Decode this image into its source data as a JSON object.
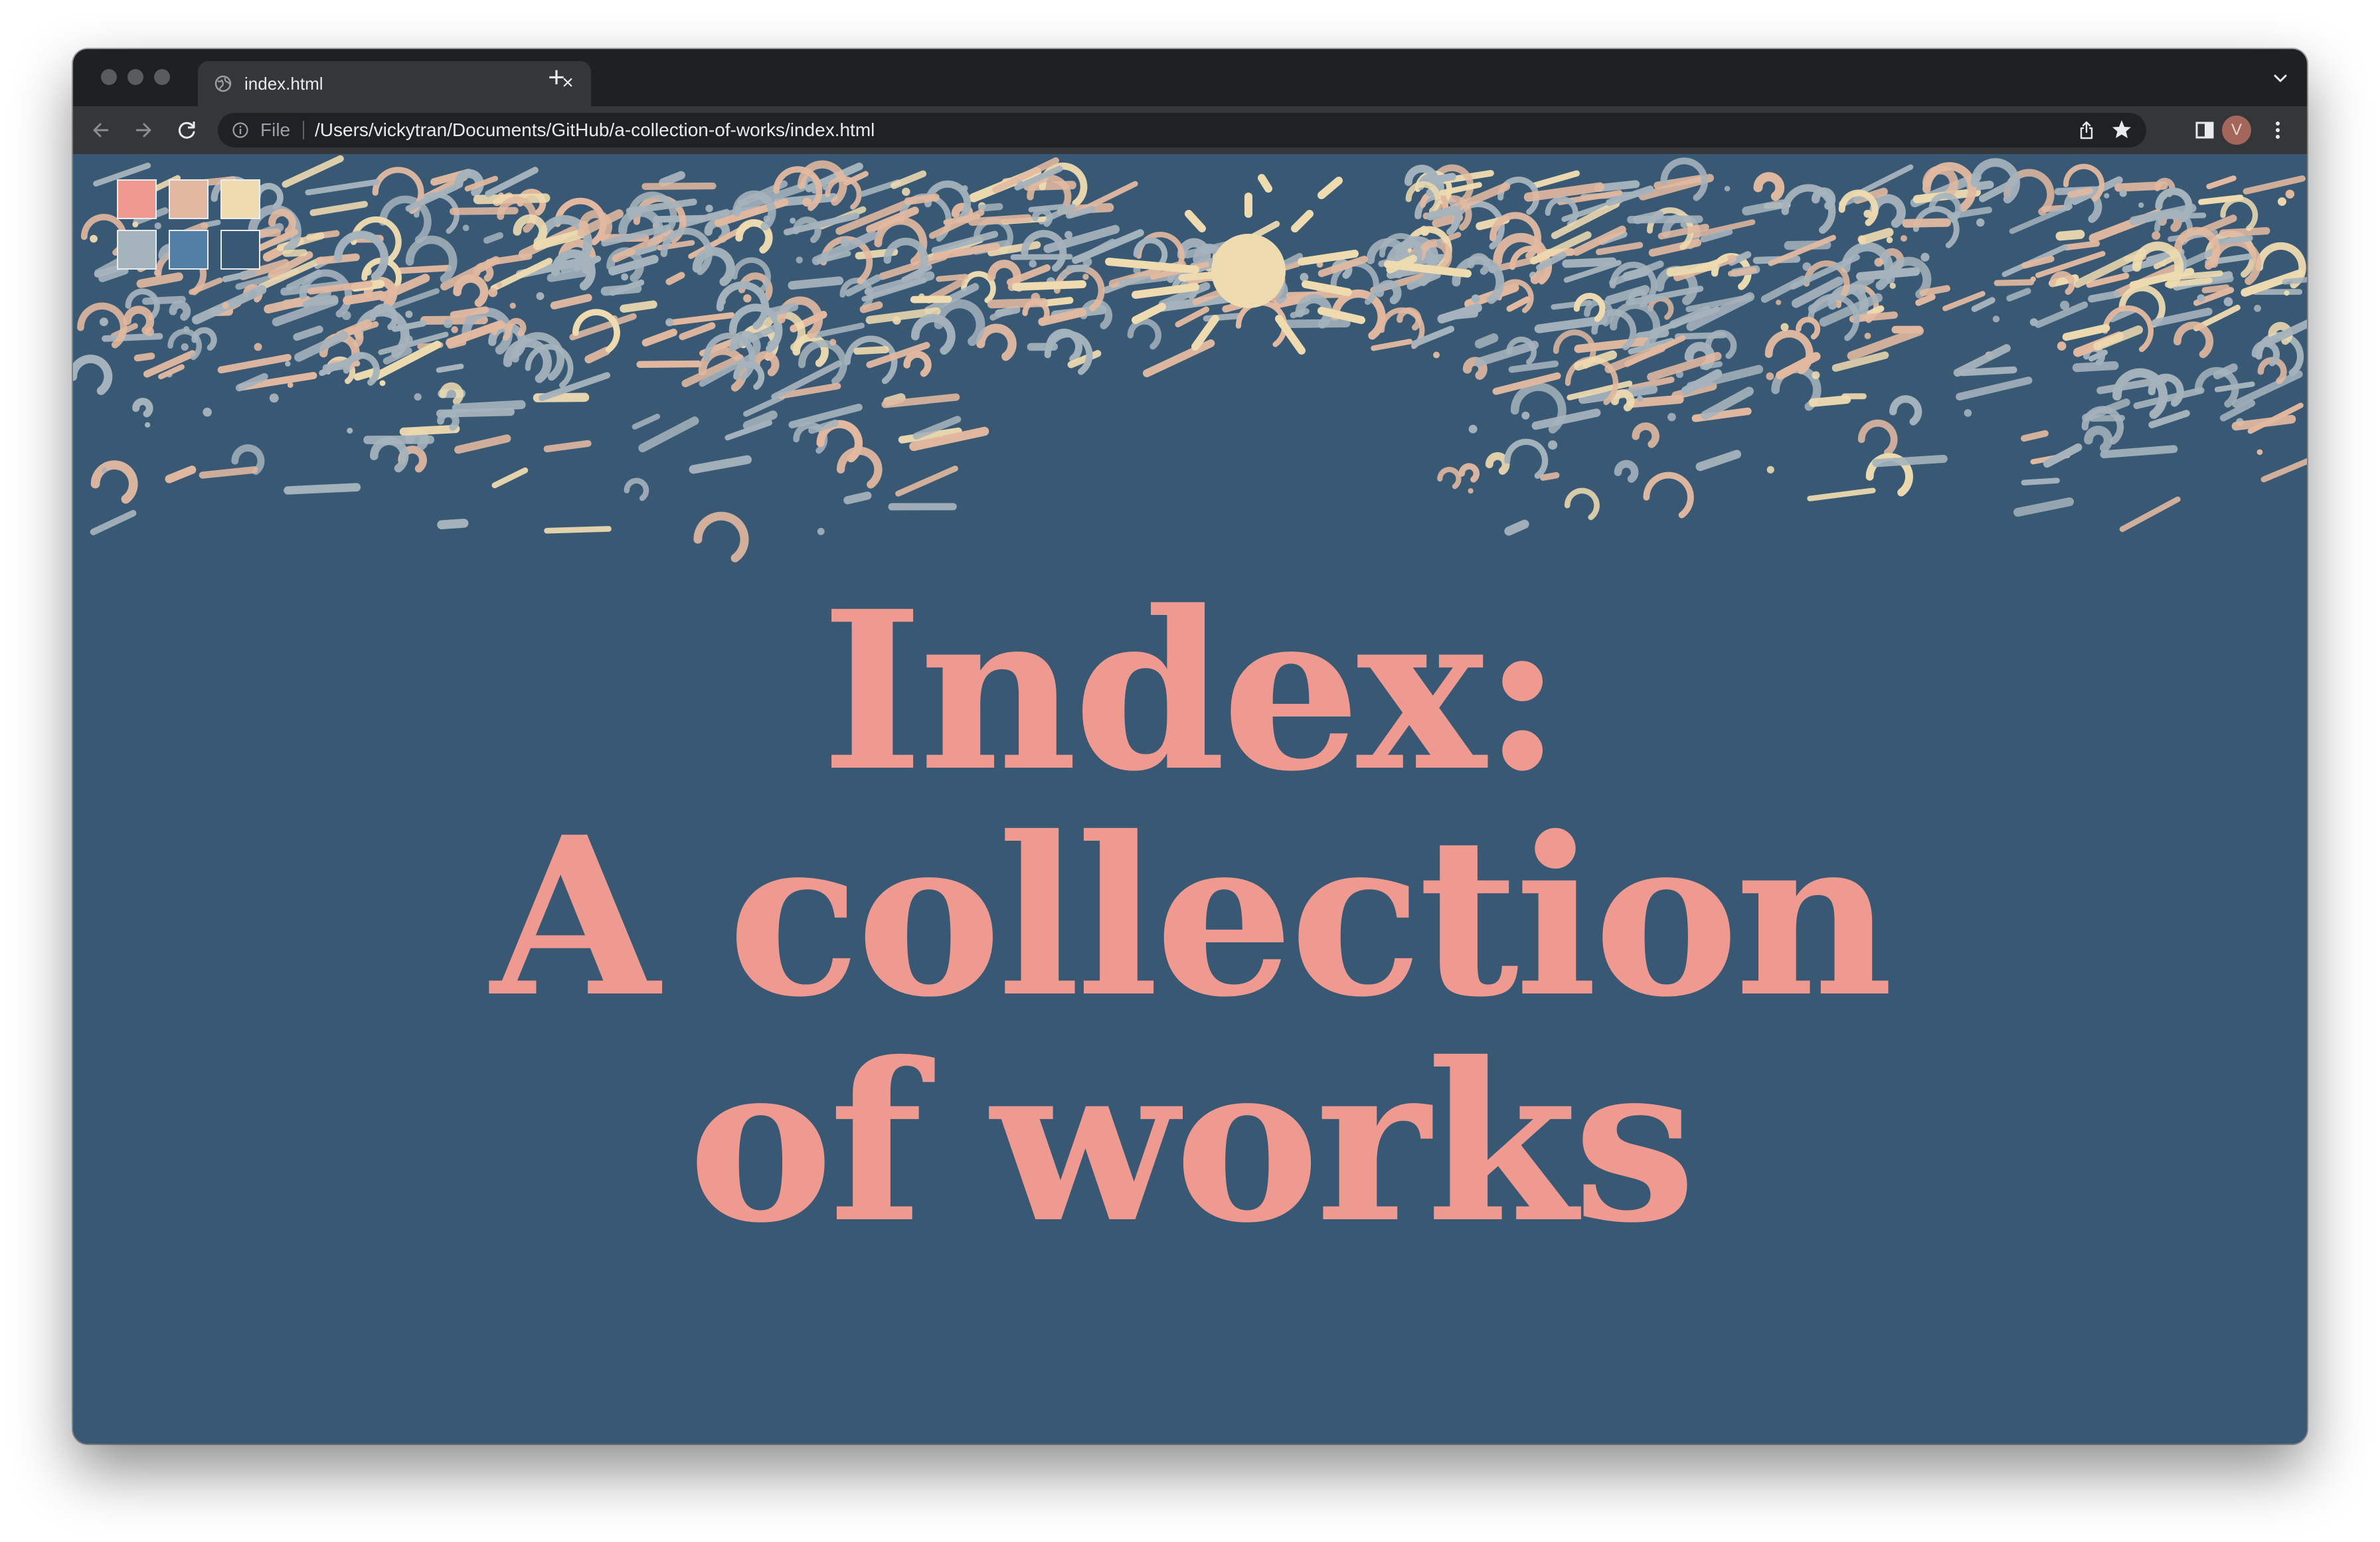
{
  "browser": {
    "tab": {
      "title": "index.html",
      "close_glyph": "×"
    },
    "new_tab_glyph": "+",
    "omnibox": {
      "scheme_label": "File",
      "url": "/Users/vickytran/Documents/GitHub/a-collection-of-works/index.html"
    },
    "profile_initial": "V"
  },
  "page": {
    "headline_lines": [
      "Index:",
      "A collection",
      "of works"
    ],
    "palette": [
      "#ee9a90",
      "#e2b9a0",
      "#eedbb0",
      "#a5b3bc",
      "#527fa6",
      "#385874"
    ]
  },
  "colors": {
    "page_background": "#385874",
    "headline": "#ee9a90",
    "chrome_tabbar": "#1f2023",
    "chrome_toolbar": "#35363a"
  },
  "icons": [
    "globe-icon",
    "close-icon",
    "plus-icon",
    "chevron-down-icon",
    "back-arrow-icon",
    "forward-arrow-icon",
    "reload-icon",
    "info-icon",
    "share-icon",
    "star-icon",
    "side-panel-icon",
    "more-vert-icon"
  ]
}
